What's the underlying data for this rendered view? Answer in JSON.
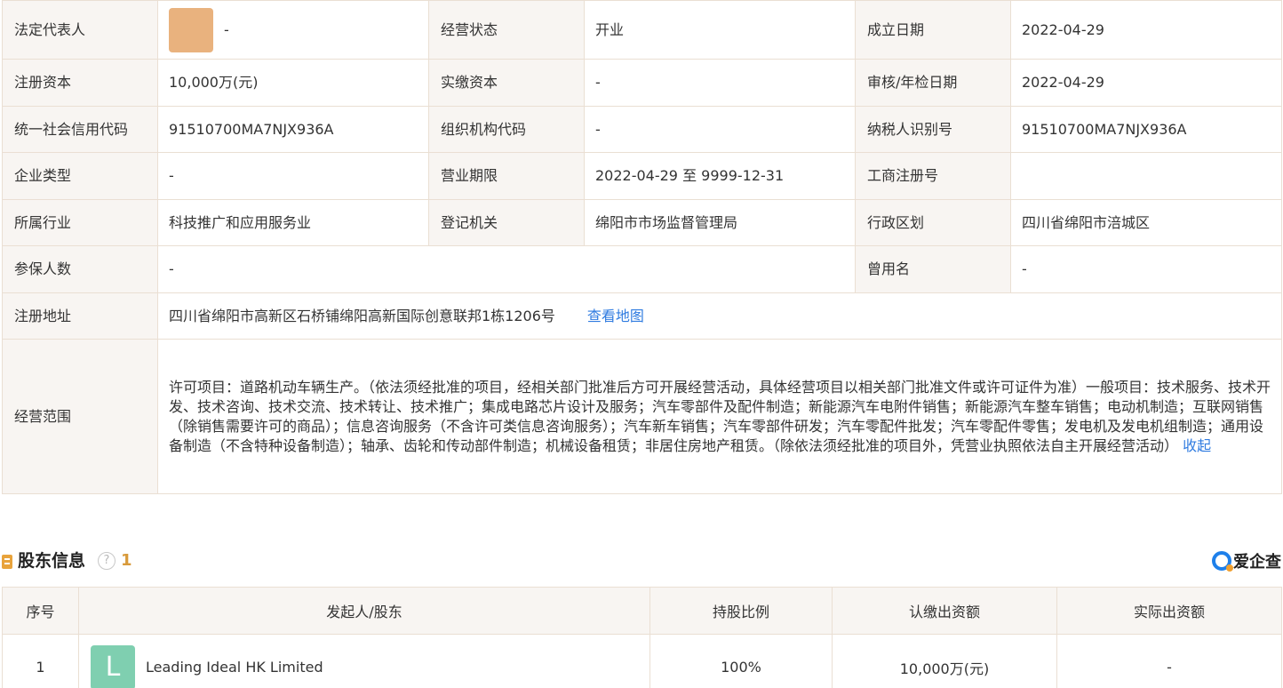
{
  "company_info": {
    "legal_rep_label": "法定代表人",
    "legal_rep_value": "-",
    "status_label": "经营状态",
    "status_value": "开业",
    "established_label": "成立日期",
    "established_value": "2022-04-29",
    "reg_capital_label": "注册资本",
    "reg_capital_value": "10,000万(元)",
    "paid_capital_label": "实缴资本",
    "paid_capital_value": "-",
    "approval_date_label": "审核/年检日期",
    "approval_date_value": "2022-04-29",
    "credit_code_label": "统一社会信用代码",
    "credit_code_value": "91510700MA7NJX936A",
    "org_code_label": "组织机构代码",
    "org_code_value": "-",
    "taxpayer_id_label": "纳税人识别号",
    "taxpayer_id_value": "91510700MA7NJX936A",
    "company_type_label": "企业类型",
    "company_type_value": "-",
    "business_term_label": "营业期限",
    "business_term_value": "2022-04-29 至 9999-12-31",
    "biz_reg_no_label": "工商注册号",
    "biz_reg_no_value": "",
    "industry_label": "所属行业",
    "industry_value": "科技推广和应用服务业",
    "reg_authority_label": "登记机关",
    "reg_authority_value": "绵阳市市场监督管理局",
    "division_label": "行政区划",
    "division_value": "四川省绵阳市涪城区",
    "insured_label": "参保人数",
    "insured_value": "-",
    "former_name_label": "曾用名",
    "former_name_value": "-",
    "address_label": "注册地址",
    "address_value": "四川省绵阳市高新区石桥铺绵阳高新国际创意联邦1栋1206号",
    "view_map_label": "查看地图",
    "scope_label": "经营范围",
    "scope_value": "许可项目：道路机动车辆生产。（依法须经批准的项目，经相关部门批准后方可开展经营活动，具体经营项目以相关部门批准文件或许可证件为准）一般项目：技术服务、技术开发、技术咨询、技术交流、技术转让、技术推广；集成电路芯片设计及服务；汽车零部件及配件制造；新能源汽车电附件销售；新能源汽车整车销售；电动机制造；互联网销售（除销售需要许可的商品）；信息咨询服务（不含许可类信息咨询服务）；汽车新车销售；汽车零部件研发；汽车零配件批发；汽车零配件零售；发电机及发电机组制造；通用设备制造（不含特种设备制造）；轴承、齿轮和传动部件制造；机械设备租赁；非居住房地产租赁。（除依法须经批准的项目外，凭营业执照依法自主开展经营活动）",
    "collapse_label": "收起"
  },
  "shareholders": {
    "title": "股东信息",
    "help_glyph": "?",
    "count": "1",
    "brand": "爱企查",
    "headers": {
      "index": "序号",
      "holder": "发起人/股东",
      "ratio": "持股比例",
      "subscribed": "认缴出资额",
      "actual": "实际出资额"
    },
    "rows": [
      {
        "index": "1",
        "avatar_letter": "L",
        "name": "Leading Ideal HK Limited",
        "ratio": "100%",
        "subscribed": "10,000万(元)",
        "actual": "-"
      }
    ]
  },
  "colors": {
    "label_bg": "#f8f5f2",
    "border": "#eadfd3",
    "link": "#2f7be0",
    "avatar_orange": "#e9b27e",
    "avatar_green": "#7fcfb0",
    "count_orange": "#d89a3a"
  }
}
